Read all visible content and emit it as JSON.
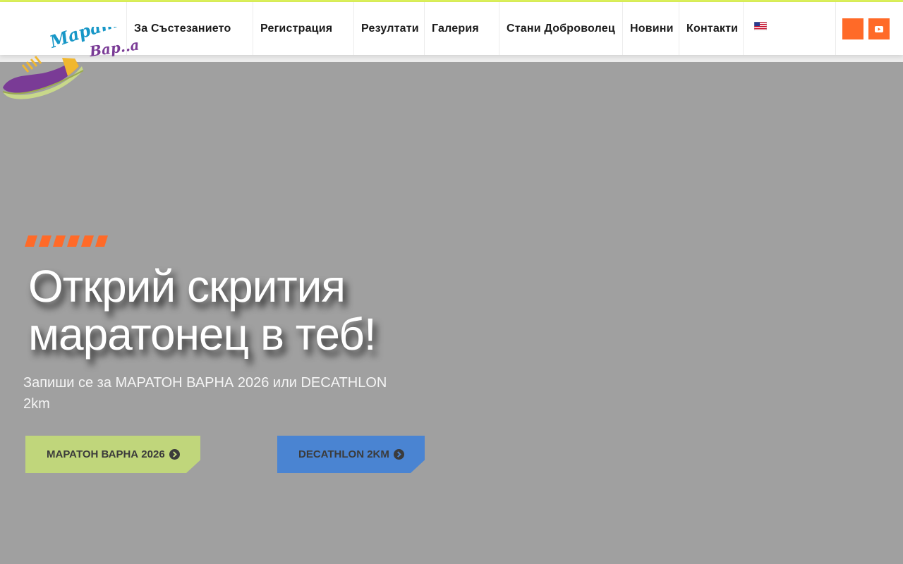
{
  "logo": {
    "text_line1": "Марат",
    "text_line2": "Вар..а"
  },
  "nav": {
    "items": [
      {
        "label": "За Състезанието",
        "name": "nav-item-about-race"
      },
      {
        "label": "Регистрация",
        "name": "nav-item-registration"
      },
      {
        "label": "Резултати",
        "name": "nav-item-results"
      },
      {
        "label": "Галерия",
        "name": "nav-item-gallery"
      },
      {
        "label": "Стани Доброволец",
        "name": "nav-item-volunteer"
      },
      {
        "label": "Новини",
        "name": "nav-item-news"
      },
      {
        "label": "Контакти",
        "name": "nav-item-contacts"
      }
    ],
    "language_icon": "us-flag-icon"
  },
  "social": {
    "icons": [
      "facebook-icon",
      "youtube-icon"
    ]
  },
  "hero": {
    "title_line1": "Открий скрития",
    "title_line2": "маратонец в теб!",
    "subtitle_line1": "Запиши се за МАРАТОН ВАРНА 2026 или DECATHLON",
    "subtitle_line2": "2km",
    "buttons": {
      "marathon_label": "МАРАТОН ВАРНА 2026",
      "decathlon_label": "DECATHLON 2KM"
    }
  },
  "colors": {
    "accent_orange": "#ff6a28",
    "top_line": "#dcf15a",
    "btn_green": "#c0d67b",
    "btn_blue": "#4a84d2",
    "hero_bg": "#a0a0a0"
  }
}
